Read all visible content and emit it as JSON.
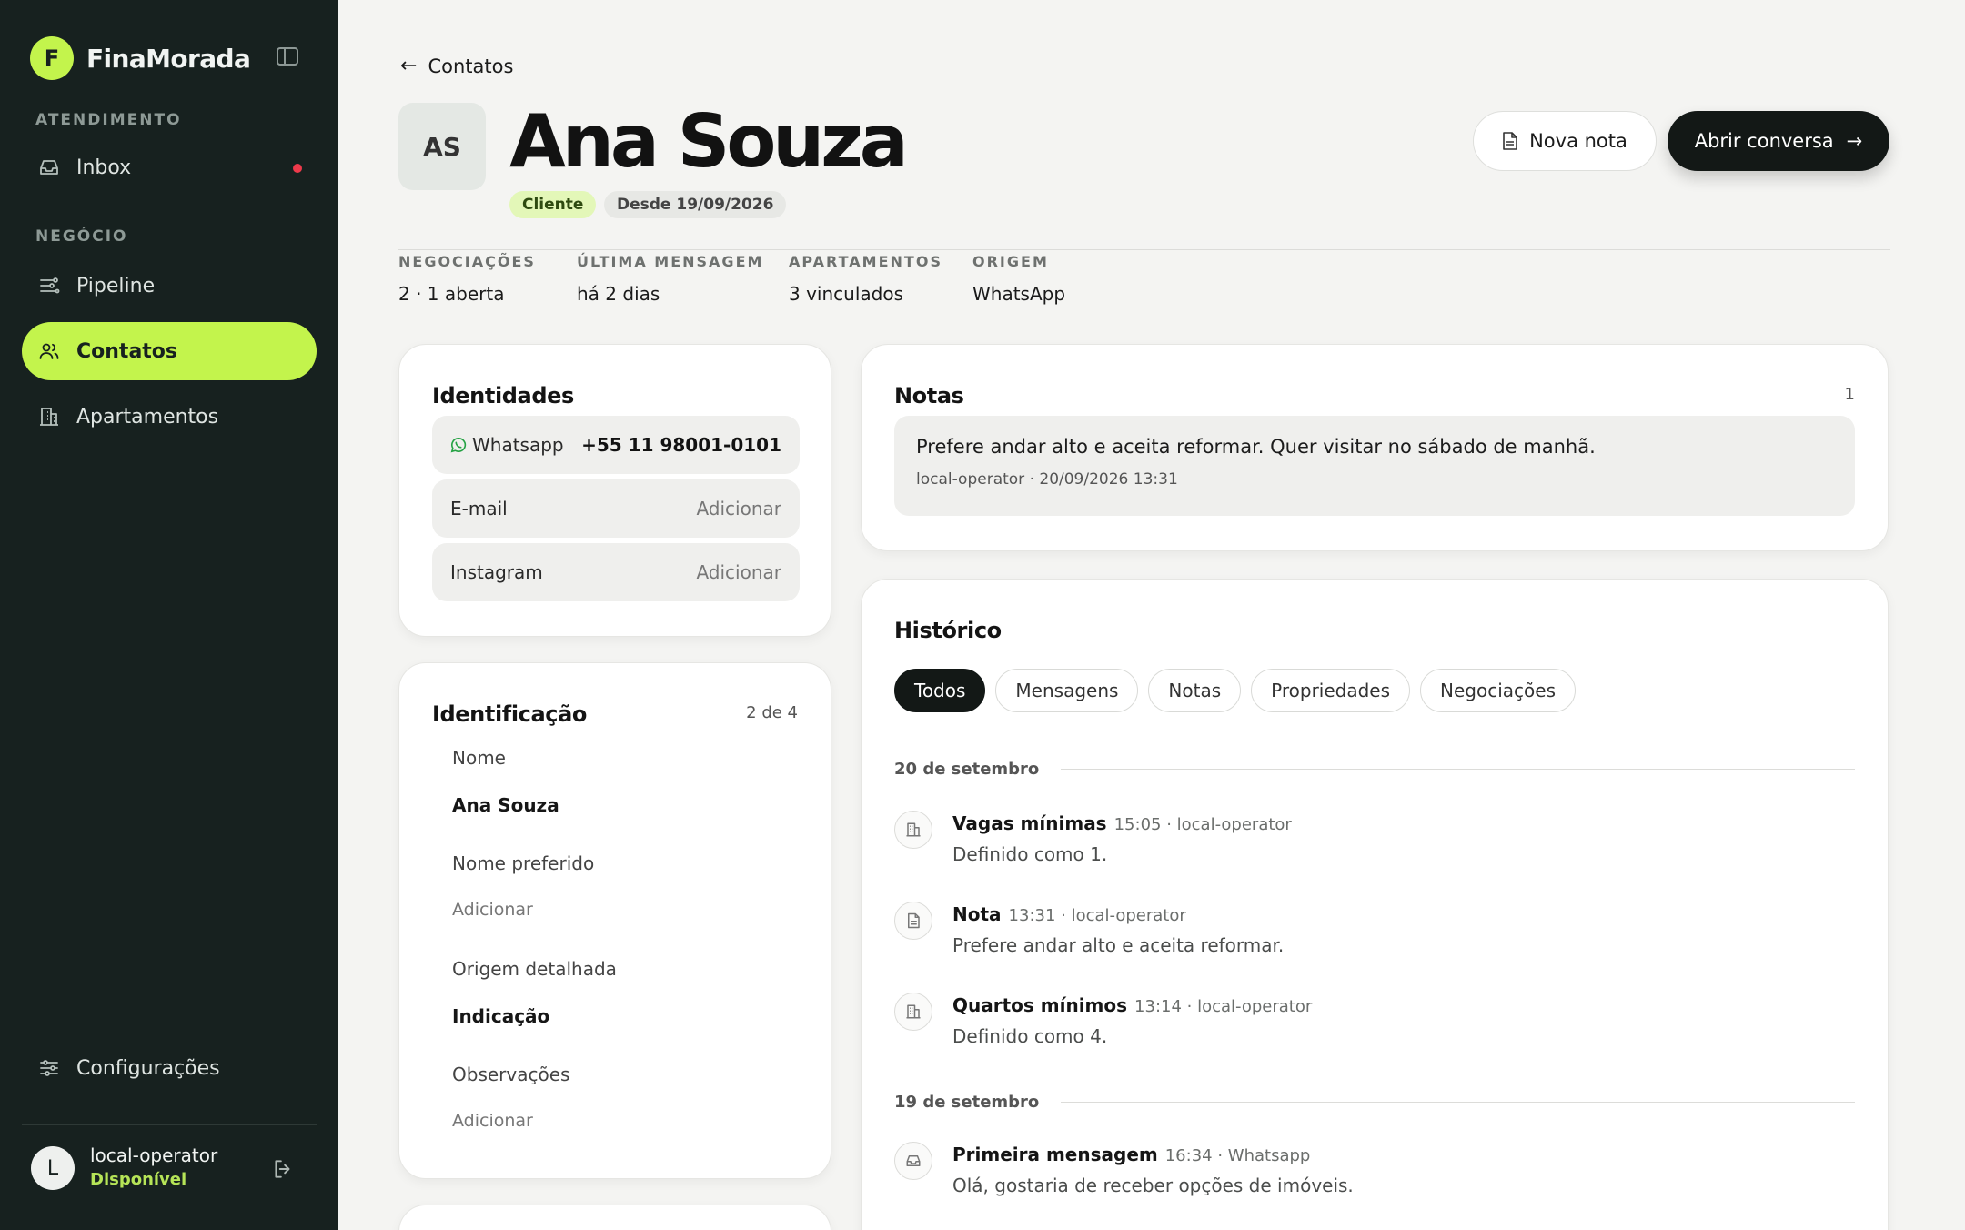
{
  "brand": {
    "initial": "F",
    "name": "FinaMorada"
  },
  "sidebar": {
    "sections": [
      "ATENDIMENTO",
      "NEGÓCIO"
    ],
    "items": [
      {
        "label": "Inbox",
        "icon": "inbox-icon",
        "badge": "unread"
      },
      {
        "label": "Pipeline",
        "icon": "pipeline-icon"
      },
      {
        "label": "Contatos",
        "icon": "contacts-icon",
        "active": true
      },
      {
        "label": "Apartamentos",
        "icon": "building-icon"
      }
    ],
    "settings": "Configurações",
    "user": {
      "initial": "L",
      "name": "local-operator",
      "status": "Disponível"
    }
  },
  "header": {
    "back": "Contatos",
    "avatar": "AS",
    "name": "Ana Souza",
    "tags": [
      "Cliente",
      "Desde 19/09/2026"
    ],
    "new_note": "Nova nota",
    "open_chat": "Abrir conversa"
  },
  "stats": [
    {
      "label": "NEGOCIAÇÕES",
      "value": "2 · 1 aberta"
    },
    {
      "label": "ÚLTIMA MENSAGEM",
      "value": "há 2 dias"
    },
    {
      "label": "APARTAMENTOS",
      "value": "3 vinculados"
    },
    {
      "label": "ORIGEM",
      "value": "WhatsApp"
    }
  ],
  "identities": {
    "title": "Identidades",
    "rows": [
      {
        "label": "Whatsapp",
        "value": "+55 11 98001-0101"
      },
      {
        "label": "E-mail",
        "value": "Adicionar"
      },
      {
        "label": "Instagram",
        "value": "Adicionar"
      }
    ]
  },
  "identification": {
    "title": "Identificação",
    "count": "2 de 4",
    "fields": [
      {
        "label": "Nome",
        "value": "Ana Souza"
      },
      {
        "label": "Nome preferido",
        "value": "Adicionar"
      },
      {
        "label": "Origem detalhada",
        "value": "Indicação"
      },
      {
        "label": "Observações",
        "value": "Adicionar"
      }
    ]
  },
  "notes": {
    "title": "Notas",
    "count": "1",
    "items": [
      {
        "text": "Prefere andar alto e aceita reformar. Quer visitar no sábado de manhã.",
        "meta": "local-operator · 20/09/2026 13:31"
      }
    ]
  },
  "history": {
    "title": "Histórico",
    "filters": [
      "Todos",
      "Mensagens",
      "Notas",
      "Propriedades",
      "Negociações"
    ],
    "days": [
      {
        "label": "20 de setembro",
        "events": [
          {
            "icon": "building-icon",
            "title": "Vagas mínimas",
            "meta": "15:05 · local-operator",
            "desc": "Definido como 1."
          },
          {
            "icon": "note-icon",
            "title": "Nota",
            "meta": "13:31 · local-operator",
            "desc": "Prefere andar alto e aceita reformar."
          },
          {
            "icon": "building-icon",
            "title": "Quartos mínimos",
            "meta": "13:14 · local-operator",
            "desc": "Definido como 4."
          }
        ]
      },
      {
        "label": "19 de setembro",
        "events": [
          {
            "icon": "inbox-icon",
            "title": "Primeira mensagem",
            "meta": "16:34 · Whatsapp",
            "desc": "Olá, gostaria de receber opções de imóveis."
          }
        ]
      }
    ]
  },
  "colors": {
    "accent": "#c3f44c",
    "sidebar": "#17211f",
    "dark_button": "#131816",
    "alert": "#ee3a4b",
    "whatsapp": "#25a244"
  }
}
